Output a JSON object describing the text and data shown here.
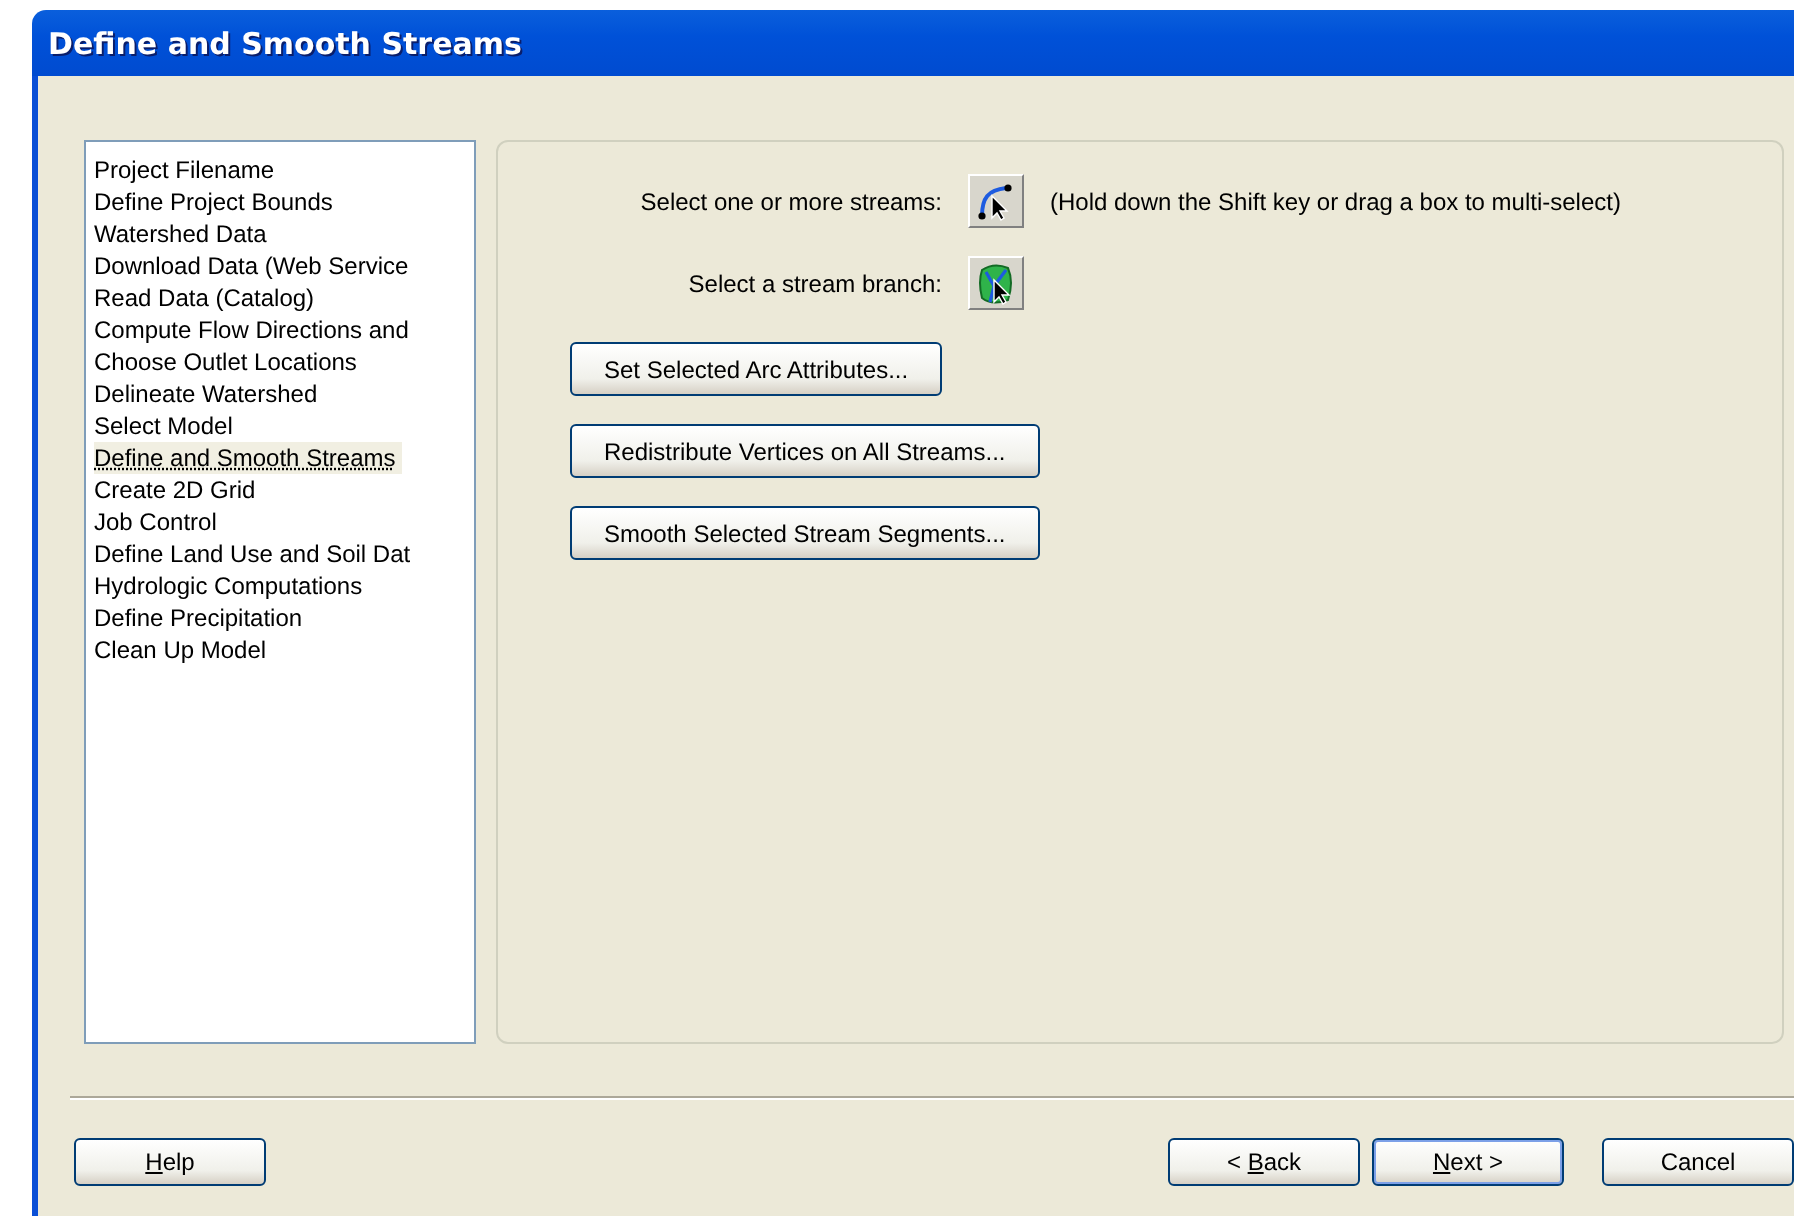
{
  "window": {
    "title": "Define and Smooth Streams"
  },
  "steps": [
    {
      "label": "Project Filename",
      "selected": false
    },
    {
      "label": "Define Project Bounds",
      "selected": false
    },
    {
      "label": "Watershed Data",
      "selected": false
    },
    {
      "label": "Download Data (Web Service",
      "selected": false
    },
    {
      "label": "Read Data (Catalog)",
      "selected": false
    },
    {
      "label": "Compute Flow Directions and",
      "selected": false
    },
    {
      "label": "Choose Outlet Locations",
      "selected": false
    },
    {
      "label": "Delineate Watershed",
      "selected": false
    },
    {
      "label": "Select Model",
      "selected": false
    },
    {
      "label": "Define and Smooth Streams",
      "selected": true
    },
    {
      "label": "Create 2D Grid",
      "selected": false
    },
    {
      "label": "Job Control",
      "selected": false
    },
    {
      "label": "Define Land Use and Soil Dat",
      "selected": false
    },
    {
      "label": "Hydrologic Computations",
      "selected": false
    },
    {
      "label": "Define Precipitation",
      "selected": false
    },
    {
      "label": "Clean Up Model",
      "selected": false
    }
  ],
  "selection_tools": [
    {
      "label": "Select one or more streams:",
      "kind": "streams",
      "hint": "(Hold down the Shift key or drag a box to multi-select)"
    },
    {
      "label": "Select a stream branch:",
      "kind": "branch"
    }
  ],
  "actions": [
    "Set Selected Arc Attributes...",
    "Redistribute Vertices on All Streams...",
    "Smooth Selected Stream Segments..."
  ],
  "footer": {
    "help": {
      "key": "H",
      "after": "elp"
    },
    "back": {
      "before": "< ",
      "key": "B",
      "after": "ack"
    },
    "next": {
      "key": "N",
      "after": "ext >",
      "default": true
    },
    "cancel": {
      "before": "Cancel"
    }
  }
}
